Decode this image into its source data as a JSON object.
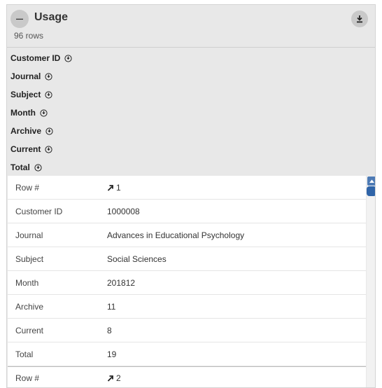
{
  "panel": {
    "title": "Usage",
    "rows_count": "96 rows",
    "collapse_symbol": "–",
    "collapse_icon": "minus-icon",
    "download_icon": "download-icon"
  },
  "sort_fields": [
    {
      "label": "Customer ID",
      "icon": "sort-down-circle-icon"
    },
    {
      "label": "Journal",
      "icon": "sort-down-circle-icon"
    },
    {
      "label": "Subject",
      "icon": "sort-down-circle-icon"
    },
    {
      "label": "Month",
      "icon": "sort-down-circle-icon"
    },
    {
      "label": "Archive",
      "icon": "sort-down-circle-icon"
    },
    {
      "label": "Current",
      "icon": "sort-down-circle-icon"
    },
    {
      "label": "Total",
      "icon": "sort-down-circle-icon"
    }
  ],
  "records": [
    {
      "row_label": "Row #",
      "row_number": "1",
      "row_icon": "arrow-up-right-icon",
      "fields": [
        {
          "label": "Customer ID",
          "value": "1000008"
        },
        {
          "label": "Journal",
          "value": "Advances in Educational Psychology"
        },
        {
          "label": "Subject",
          "value": "Social Sciences"
        },
        {
          "label": "Month",
          "value": "201812"
        },
        {
          "label": "Archive",
          "value": "11"
        },
        {
          "label": "Current",
          "value": "8"
        },
        {
          "label": "Total",
          "value": "19"
        }
      ]
    },
    {
      "row_label": "Row #",
      "row_number": "2",
      "row_icon": "arrow-up-right-icon",
      "fields": []
    }
  ],
  "colors": {
    "panel_bg": "#e8e8e8",
    "scroll_accent": "#2f64a8"
  }
}
